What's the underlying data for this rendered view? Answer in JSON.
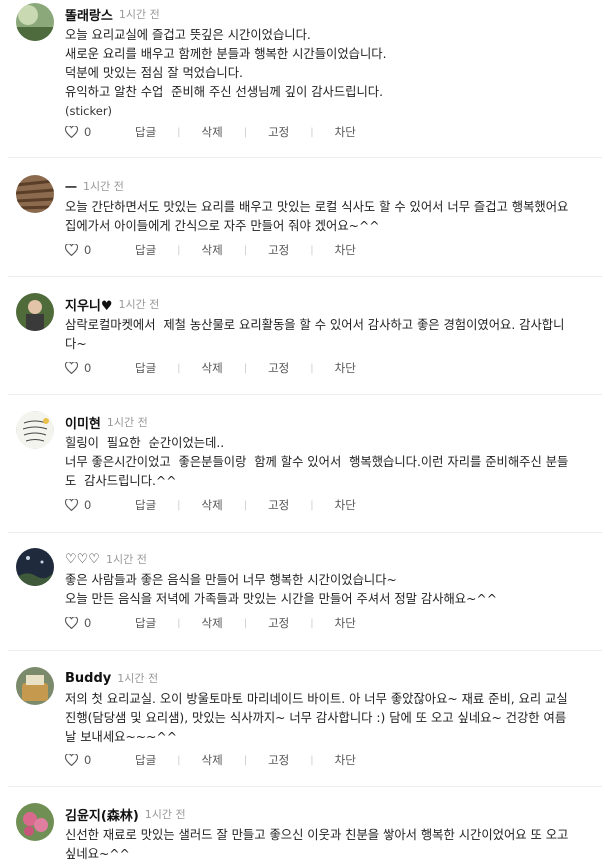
{
  "actions": {
    "reply": "답글",
    "delete": "삭제",
    "pin": "고정",
    "block": "차단"
  },
  "comments": [
    {
      "author": "똘래랑스",
      "time": "1시간 전",
      "lines": [
        "오늘 요리교실에 즐겁고 뜻깊은 시간이었습니다.",
        "새로운 요리를 배우고 함께한 분들과 행복한 시간들이었습니다.",
        "덕분에 맛있는 점심 잘 먹었습니다.",
        "유익하고 알찬 수업  준비해 주신 선생님께 깊이 감사드립니다."
      ],
      "sticker": "(sticker)",
      "likes": "0"
    },
    {
      "author": "ㅡ",
      "time": "1시간 전",
      "lines": [
        "오늘 간단하면서도 맛있는 요리를 배우고 맛있는 로컬 식사도 할 수 있어서 너무 즐겁고 행복했어요",
        "집에가서 아이들에게 간식으로 자주 만들어 줘야 겠어요~^^"
      ],
      "likes": "0"
    },
    {
      "author": "지우니♥",
      "time": "1시간 전",
      "lines": [
        "삼락로컬마켓에서  제철 농산물로 요리활동을 할 수 있어서 감사하고 좋은 경험이였어요. 감사합니",
        "다~"
      ],
      "likes": "0"
    },
    {
      "author": "이미현",
      "time": "1시간 전",
      "lines": [
        "힐링이  필요한  순간이었는데..",
        "너무 좋은시간이었고  좋은분들이랑  함께 할수 있어서  행복했습니다.이런 자리를 준비해주신 분들",
        "도  감사드립니다.^^"
      ],
      "likes": "0"
    },
    {
      "author": "♡♡♡",
      "time": "1시간 전",
      "lines": [
        "좋은 사람들과 좋은 음식을 만들어 너무 행복한 시간이었습니다~",
        "오늘 만든 음식을 저녁에 가족들과 맛있는 시간을 만들어 주셔서 정말 감사해요~^^"
      ],
      "likes": "0"
    },
    {
      "author": "Buddy",
      "time": "1시간 전",
      "lines": [
        "저의 첫 요리교실. 오이 방울토마토 마리네이드 바이트. 아 너무 좋았잖아요~ 재료 준비, 요리 교실",
        "진행(담당샘 및 요리샘), 맛있는 식사까지~ 너무 감사합니다 :) 담에 또 오고 싶네요~ 건강한 여름",
        "날 보내세요~~~^^"
      ],
      "likes": "0"
    },
    {
      "author": "김윤지(森林)",
      "time": "1시간 전",
      "lines": [
        "신선한 재료로 맛있는 샐러드 잘 만들고 좋으신 이웃과 친분을 쌓아서 행복한 시간이었어요 또 오고",
        "싶네요~^^"
      ]
    }
  ]
}
